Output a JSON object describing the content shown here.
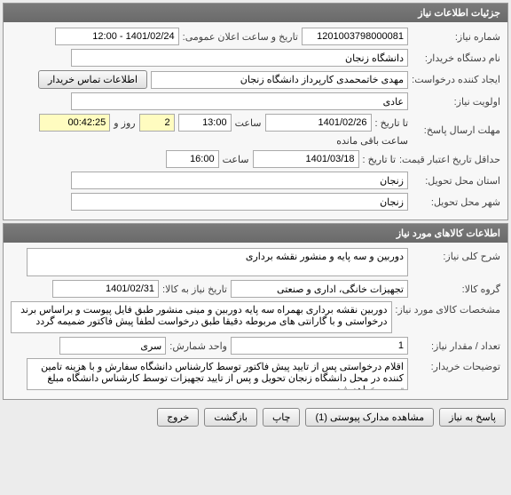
{
  "panel1": {
    "title": "جزئیات اطلاعات نیاز",
    "need_no_label": "شماره نیاز:",
    "need_no": "1201003798000081",
    "announce_label": "تاریخ و ساعت اعلان عمومی:",
    "announce_value": "1401/02/24 - 12:00",
    "buyer_label": "نام دستگاه خریدار:",
    "buyer_value": "دانشگاه زنجان",
    "creator_label": "ایجاد کننده درخواست:",
    "creator_value": "مهدی خاتمحمدی کارپرداز دانشگاه زنجان",
    "contact_btn": "اطلاعات تماس خریدار",
    "priority_label": "اولویت نیاز:",
    "priority_value": "عادی",
    "deadline_label": "مهلت ارسال پاسخ:",
    "to_date_label": "تا تاریخ :",
    "deadline_date": "1401/02/26",
    "time_label": "ساعت",
    "deadline_time": "13:00",
    "days_value": "2",
    "days_and": "روز و",
    "countdown": "00:42:25",
    "remaining": "ساعت باقی مانده",
    "min_credit_label": "حداقل تاریخ اعتبار قیمت:",
    "credit_date": "1401/03/18",
    "credit_time": "16:00",
    "province_label": "استان محل تحویل:",
    "province_value": "زنجان",
    "city_label": "شهر محل تحویل:",
    "city_value": "زنجان"
  },
  "panel2": {
    "title": "اطلاعات کالاهای مورد نیاز",
    "desc_label": "شرح کلی نیاز:",
    "desc_value": "دوربین و سه پایه و منشور نقشه برداری",
    "group_label": "گروه کالا:",
    "group_value": "تجهیزات خانگی، اداری و صنعتی",
    "need_date_label": "تاریخ نیاز به کالا:",
    "need_date_value": "1401/02/31",
    "spec_label": "مشخصات کالای مورد نیاز:",
    "spec_value": "دوربین نقشه برداری بهمراه سه پایه دوربین و مینی منشور طبق فایل پیوست و براساس برند درخواستی و با گارانتی های مربوطه دقیقا طبق درخواست لطفا پیش فاکتور ضمیمه گردد",
    "qty_label": "تعداد / مقدار نیاز:",
    "qty_value": "1",
    "unit_label": "واحد شمارش:",
    "unit_value": "سری",
    "buyer_note_label": "توضیحات خریدار:",
    "buyer_note_value": "اقلام درخواستی پس از تایید پیش فاکتور توسط کارشناس دانشگاه سفارش و با هزینه تامین کننده در محل دانشگاه زنجان تحویل و پس از تایید تجهیزات توسط کارشناس دانشگاه مبلغ تسویه خواهد شد"
  },
  "buttons": {
    "respond": "پاسخ به نیاز",
    "attach": "مشاهده مدارک پیوستی (1)",
    "print": "چاپ",
    "back": "بازگشت",
    "exit": "خروج"
  }
}
